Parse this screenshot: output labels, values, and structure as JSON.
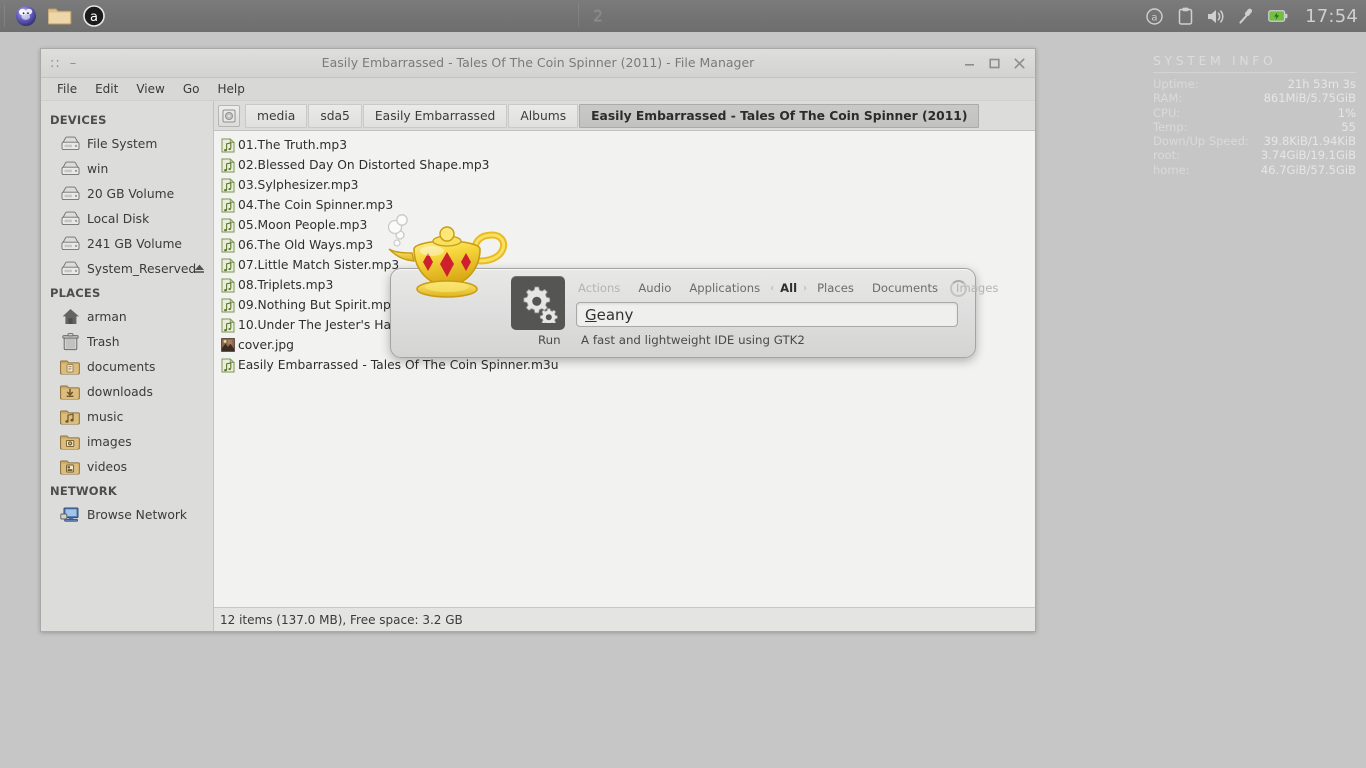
{
  "panel": {
    "launchers": [
      {
        "name": "xfce-mouse-launcher",
        "icon": "xfce-mouse-icon"
      },
      {
        "name": "file-manager-launcher",
        "icon": "folder-icon"
      },
      {
        "name": "audacious-launcher",
        "icon": "audacious-icon"
      }
    ],
    "workspace": "2",
    "tray": [
      {
        "name": "audacious-tray",
        "icon": "audacious-icon"
      },
      {
        "name": "clipboard-tray",
        "icon": "clipboard-icon"
      },
      {
        "name": "volume-tray",
        "icon": "speaker-icon"
      },
      {
        "name": "mixer-tray",
        "icon": "microphone-icon"
      },
      {
        "name": "battery-tray",
        "icon": "battery-icon"
      }
    ],
    "clock": "17:54"
  },
  "sysinfo": {
    "title": "SYSTEM INFO",
    "rows": [
      {
        "label": "Uptime:",
        "value": "21h 53m 3s"
      },
      {
        "label": "RAM:",
        "value": "861MiB/5.75GiB"
      },
      {
        "label": "CPU:",
        "value": "1%"
      },
      {
        "label": "Temp:",
        "value": "55"
      },
      {
        "label": "Down/Up Speed:",
        "value": "39.8KiB/1.94KiB"
      },
      {
        "label": "root:",
        "value": "3.74GiB/19.1GiB"
      },
      {
        "label": "home:",
        "value": "46.7GiB/57.5GiB"
      }
    ]
  },
  "filemanager": {
    "title": "Easily Embarrassed - Tales Of The Coin Spinner (2011) - File Manager",
    "titlebar": {
      "dots": "::",
      "dash": "–",
      "minimize": "–",
      "maximize": "□",
      "close": "✕"
    },
    "menu": [
      "File",
      "Edit",
      "View",
      "Go",
      "Help"
    ],
    "breadcrumbs": [
      {
        "label": "media",
        "active": false
      },
      {
        "label": "sda5",
        "active": false
      },
      {
        "label": "Easily Embarrassed",
        "active": false
      },
      {
        "label": "Albums",
        "active": false
      },
      {
        "label": "Easily Embarrassed - Tales Of The Coin Spinner (2011)",
        "active": true
      }
    ],
    "sidebar": [
      {
        "type": "header",
        "label": "DEVICES"
      },
      {
        "type": "item",
        "label": "File System",
        "icon": "drive-icon"
      },
      {
        "type": "item",
        "label": "win",
        "icon": "drive-icon"
      },
      {
        "type": "item",
        "label": "20 GB Volume",
        "icon": "drive-icon"
      },
      {
        "type": "item",
        "label": "Local Disk",
        "icon": "drive-icon"
      },
      {
        "type": "item",
        "label": "241 GB Volume",
        "icon": "drive-icon"
      },
      {
        "type": "item",
        "label": "System_Reserved",
        "icon": "drive-icon",
        "eject": true
      },
      {
        "type": "header",
        "label": "PLACES"
      },
      {
        "type": "item",
        "label": "arman",
        "icon": "home-icon"
      },
      {
        "type": "item",
        "label": "Trash",
        "icon": "trash-icon"
      },
      {
        "type": "item",
        "label": "documents",
        "icon": "folder-documents-icon"
      },
      {
        "type": "item",
        "label": "downloads",
        "icon": "folder-downloads-icon"
      },
      {
        "type": "item",
        "label": "music",
        "icon": "folder-music-icon"
      },
      {
        "type": "item",
        "label": "images",
        "icon": "folder-images-icon"
      },
      {
        "type": "item",
        "label": "videos",
        "icon": "folder-videos-icon"
      },
      {
        "type": "header",
        "label": "NETWORK"
      },
      {
        "type": "item",
        "label": "Browse Network",
        "icon": "network-icon"
      }
    ],
    "files": [
      {
        "name": "01.The Truth.mp3",
        "icon": "audio-file-icon"
      },
      {
        "name": "02.Blessed Day On Distorted Shape.mp3",
        "icon": "audio-file-icon"
      },
      {
        "name": "03.Sylphesizer.mp3",
        "icon": "audio-file-icon"
      },
      {
        "name": "04.The Coin Spinner.mp3",
        "icon": "audio-file-icon"
      },
      {
        "name": "05.Moon People.mp3",
        "icon": "audio-file-icon"
      },
      {
        "name": "06.The Old Ways.mp3",
        "icon": "audio-file-icon"
      },
      {
        "name": "07.Little Match Sister.mp3",
        "icon": "audio-file-icon"
      },
      {
        "name": "08.Triplets.mp3",
        "icon": "audio-file-icon"
      },
      {
        "name": "09.Nothing But Spirit.mp3",
        "icon": "audio-file-icon"
      },
      {
        "name": "10.Under The Jester's Hat.mp3",
        "icon": "audio-file-icon"
      },
      {
        "name": "cover.jpg",
        "icon": "image-file-icon"
      },
      {
        "name": "Easily Embarrassed - Tales Of The Coin Spinner.m3u",
        "icon": "audio-file-icon"
      }
    ],
    "status": "12 items (137.0 MB), Free space: 3.2 GB"
  },
  "synapse": {
    "categories": [
      {
        "label": "Actions",
        "state": "dim"
      },
      {
        "label": "Audio",
        "state": "normal"
      },
      {
        "label": "Applications",
        "state": "normal"
      },
      {
        "label": "All",
        "state": "active"
      },
      {
        "label": "Places",
        "state": "normal"
      },
      {
        "label": "Documents",
        "state": "normal"
      },
      {
        "label": "Images",
        "state": "dim"
      }
    ],
    "arrow_left": "‹",
    "arrow_right": "›",
    "query": "Geany",
    "query_mnemonic": "G",
    "query_rest": "eany",
    "action": "Run",
    "description": "A fast and lightweight IDE using GTK2",
    "result_icon": "gears-icon",
    "app_icon": "synapse-lamp-icon"
  },
  "colors": {
    "panel": "#737373",
    "desktop": "#c6c6c6",
    "window_bg": "#d8d8d6",
    "list_bg": "#f2f2f0",
    "accent_active": "#c9c9c7"
  }
}
